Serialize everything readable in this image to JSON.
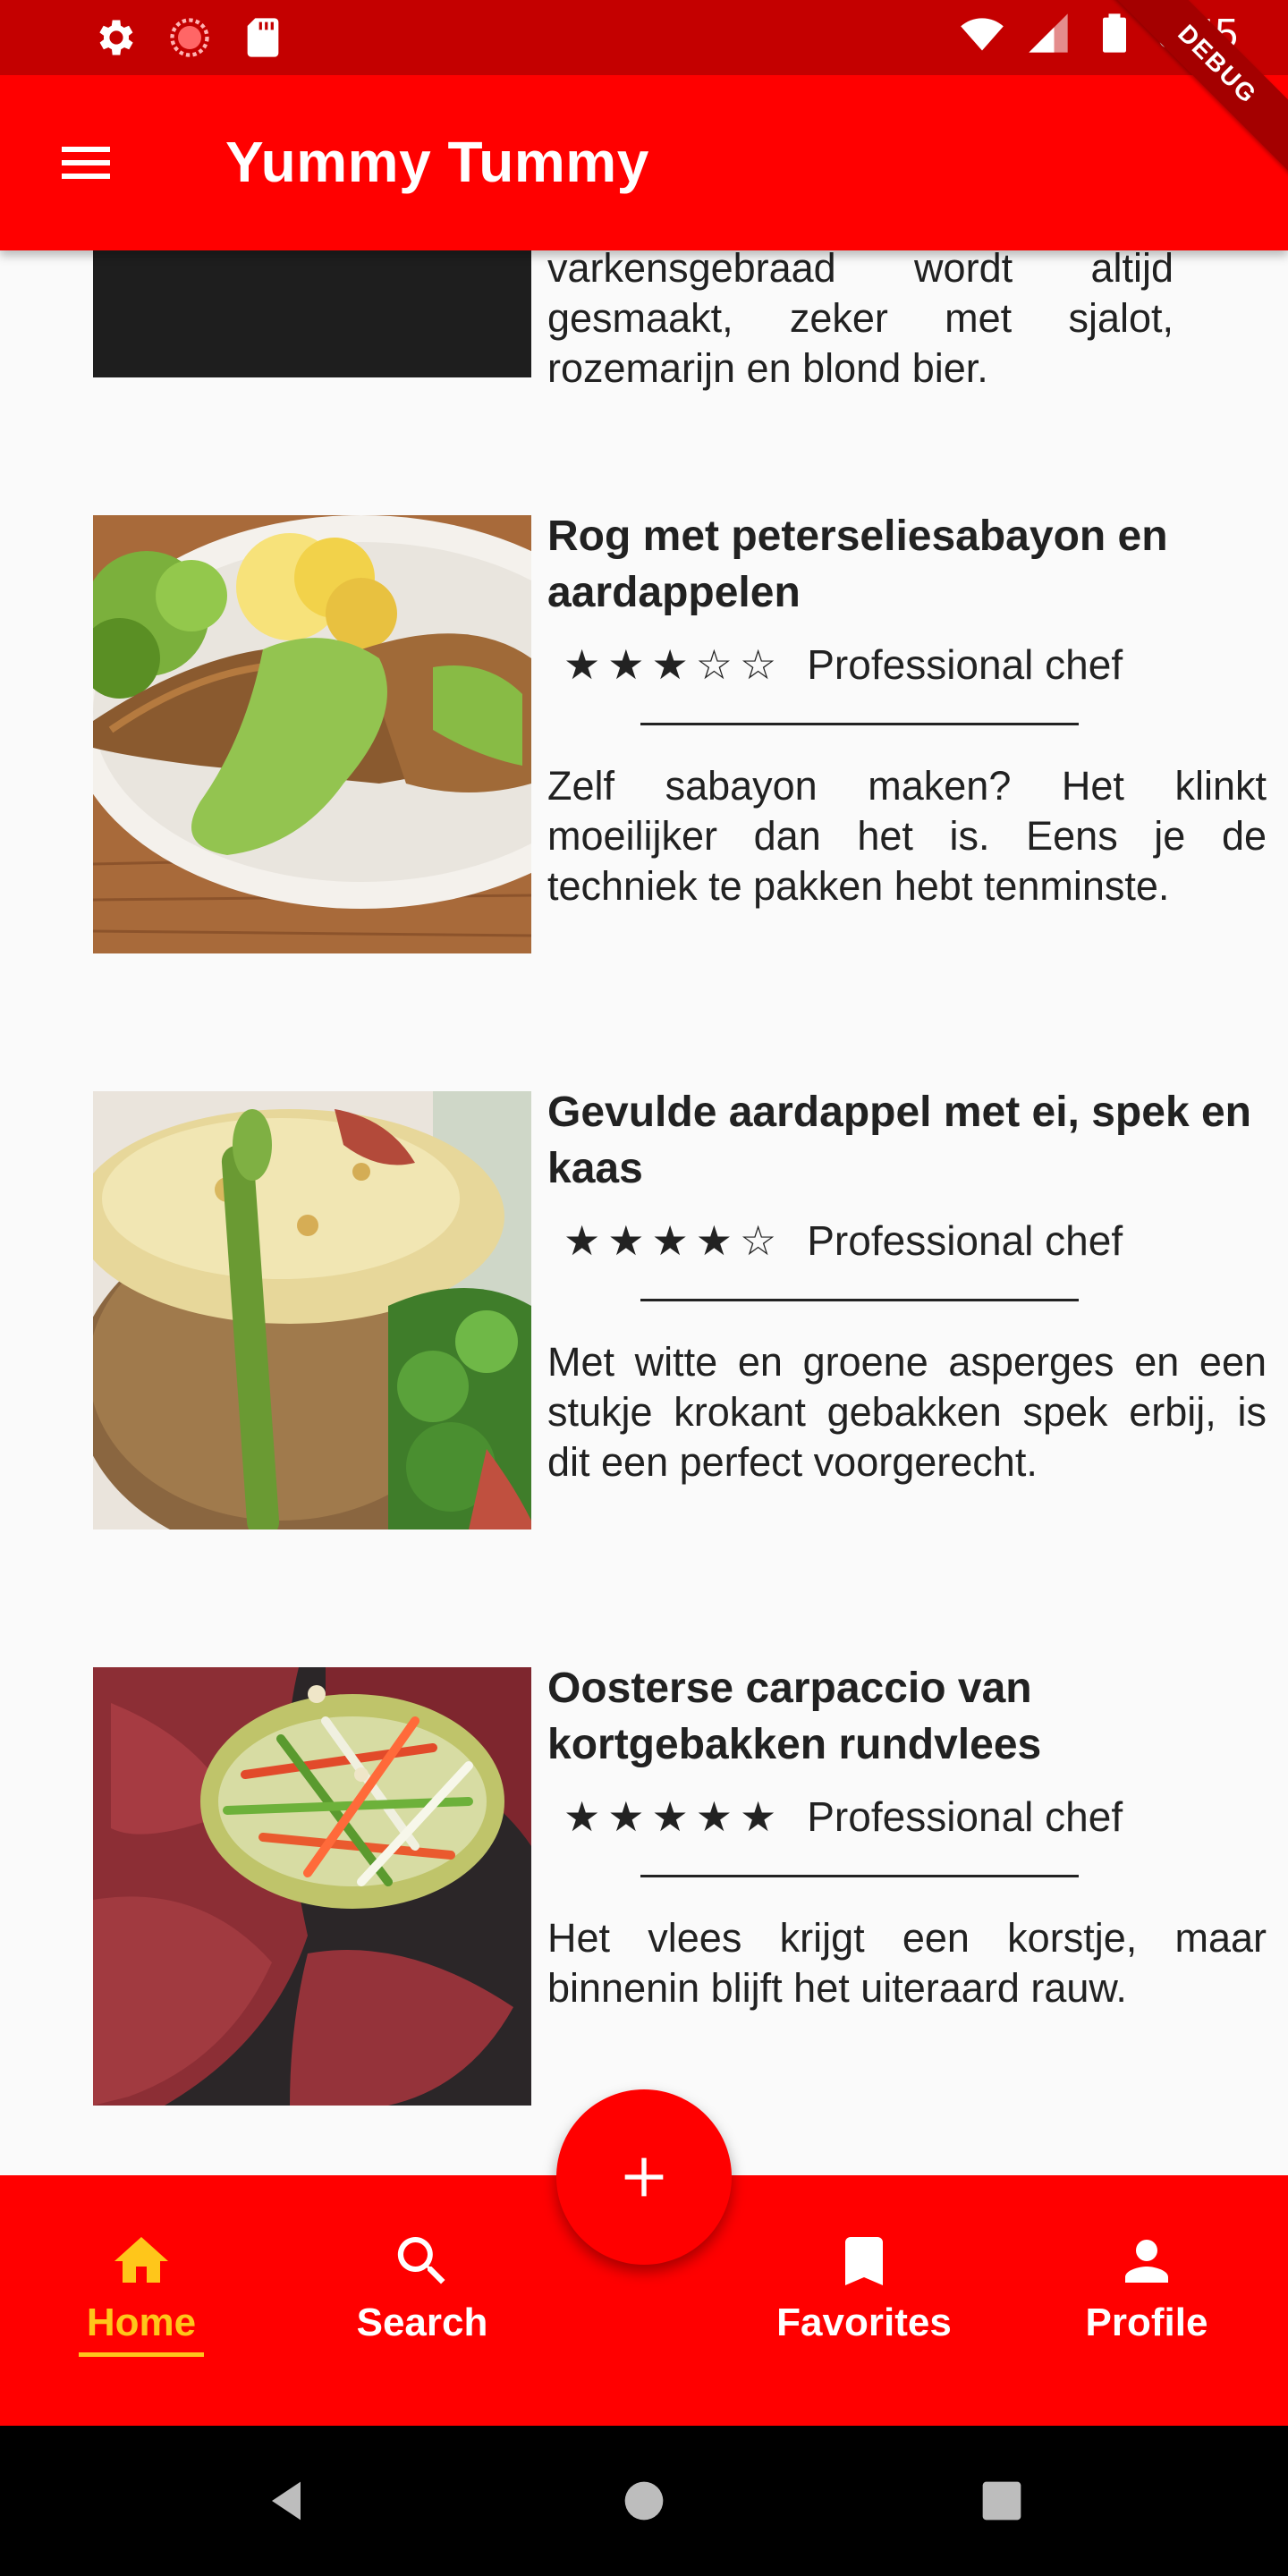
{
  "status_bar": {
    "time": "3:45",
    "icons": [
      "settings-gear-icon",
      "circle-progress-icon",
      "sd-card-icon",
      "wifi-icon",
      "cell-signal-icon",
      "battery-icon"
    ]
  },
  "app_bar": {
    "title": "Yummy Tummy",
    "debug_badge": "DEBUG",
    "menu_icon": "hamburger-menu-icon"
  },
  "partial_recipe": {
    "description": "varkensgebraad wordt altijd gesmaakt, zeker met sjalot, rozemarijn en blond bier."
  },
  "recipes": [
    {
      "title": "Rog met peterseliesabayon en aardappelen",
      "rating": 3,
      "max_rating": 5,
      "author": "Professional chef",
      "description": "Zelf sabayon maken? Het klinkt moeilijker dan het is. Eens je de techniek te pakken hebt tenminste."
    },
    {
      "title": "Gevulde aardappel met ei, spek en kaas",
      "rating": 4,
      "max_rating": 5,
      "author": "Professional chef",
      "description": "Met witte en groene asperges en een stukje krokant gebakken spek erbij, is dit een perfect voorgerecht."
    },
    {
      "title": "Oosterse carpaccio van kortgebakken rundvlees",
      "rating": 5,
      "max_rating": 5,
      "author": "Professional chef",
      "description": "Het vlees krijgt een korstje, maar binnenin blijft het uiteraard rauw."
    }
  ],
  "bottom_nav": {
    "items": [
      {
        "label": "Home",
        "icon": "home-icon",
        "active": true
      },
      {
        "label": "Search",
        "icon": "search-icon",
        "active": false
      },
      {
        "label": "Favorites",
        "icon": "bookmark-icon",
        "active": false
      },
      {
        "label": "Profile",
        "icon": "person-icon",
        "active": false
      }
    ],
    "fab_icon": "plus-icon"
  },
  "colors": {
    "primary": "#ff0000",
    "status_bar": "#c40000",
    "active_nav": "#ffc61a"
  }
}
